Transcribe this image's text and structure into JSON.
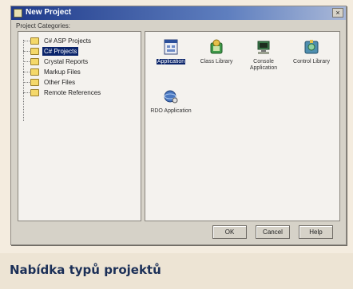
{
  "window": {
    "title": "New Project",
    "close_glyph": "×"
  },
  "tree": {
    "label": "Project Categories:",
    "items": [
      {
        "label": "C# ASP Projects",
        "icon": "folder-icon"
      },
      {
        "label": "C# Projects",
        "icon": "folder-icon",
        "selected": true
      },
      {
        "label": "Crystal Reports",
        "icon": "folder-icon"
      },
      {
        "label": "Markup Files",
        "icon": "folder-icon"
      },
      {
        "label": "Other Files",
        "icon": "folder-icon"
      },
      {
        "label": "Remote References",
        "icon": "folder-icon"
      }
    ]
  },
  "templates": [
    {
      "label": "Application",
      "icon": "application-icon",
      "selected": true
    },
    {
      "label": "Class Library",
      "icon": "class-library-icon"
    },
    {
      "label": "Console Application",
      "icon": "console-application-icon"
    },
    {
      "label": "Control Library",
      "icon": "control-library-icon"
    },
    {
      "label": "RDO Application",
      "icon": "rdo-application-icon"
    }
  ],
  "buttons": {
    "ok": "OK",
    "cancel": "Cancel",
    "help": "Help"
  },
  "caption": "Nabídka typů projektů"
}
